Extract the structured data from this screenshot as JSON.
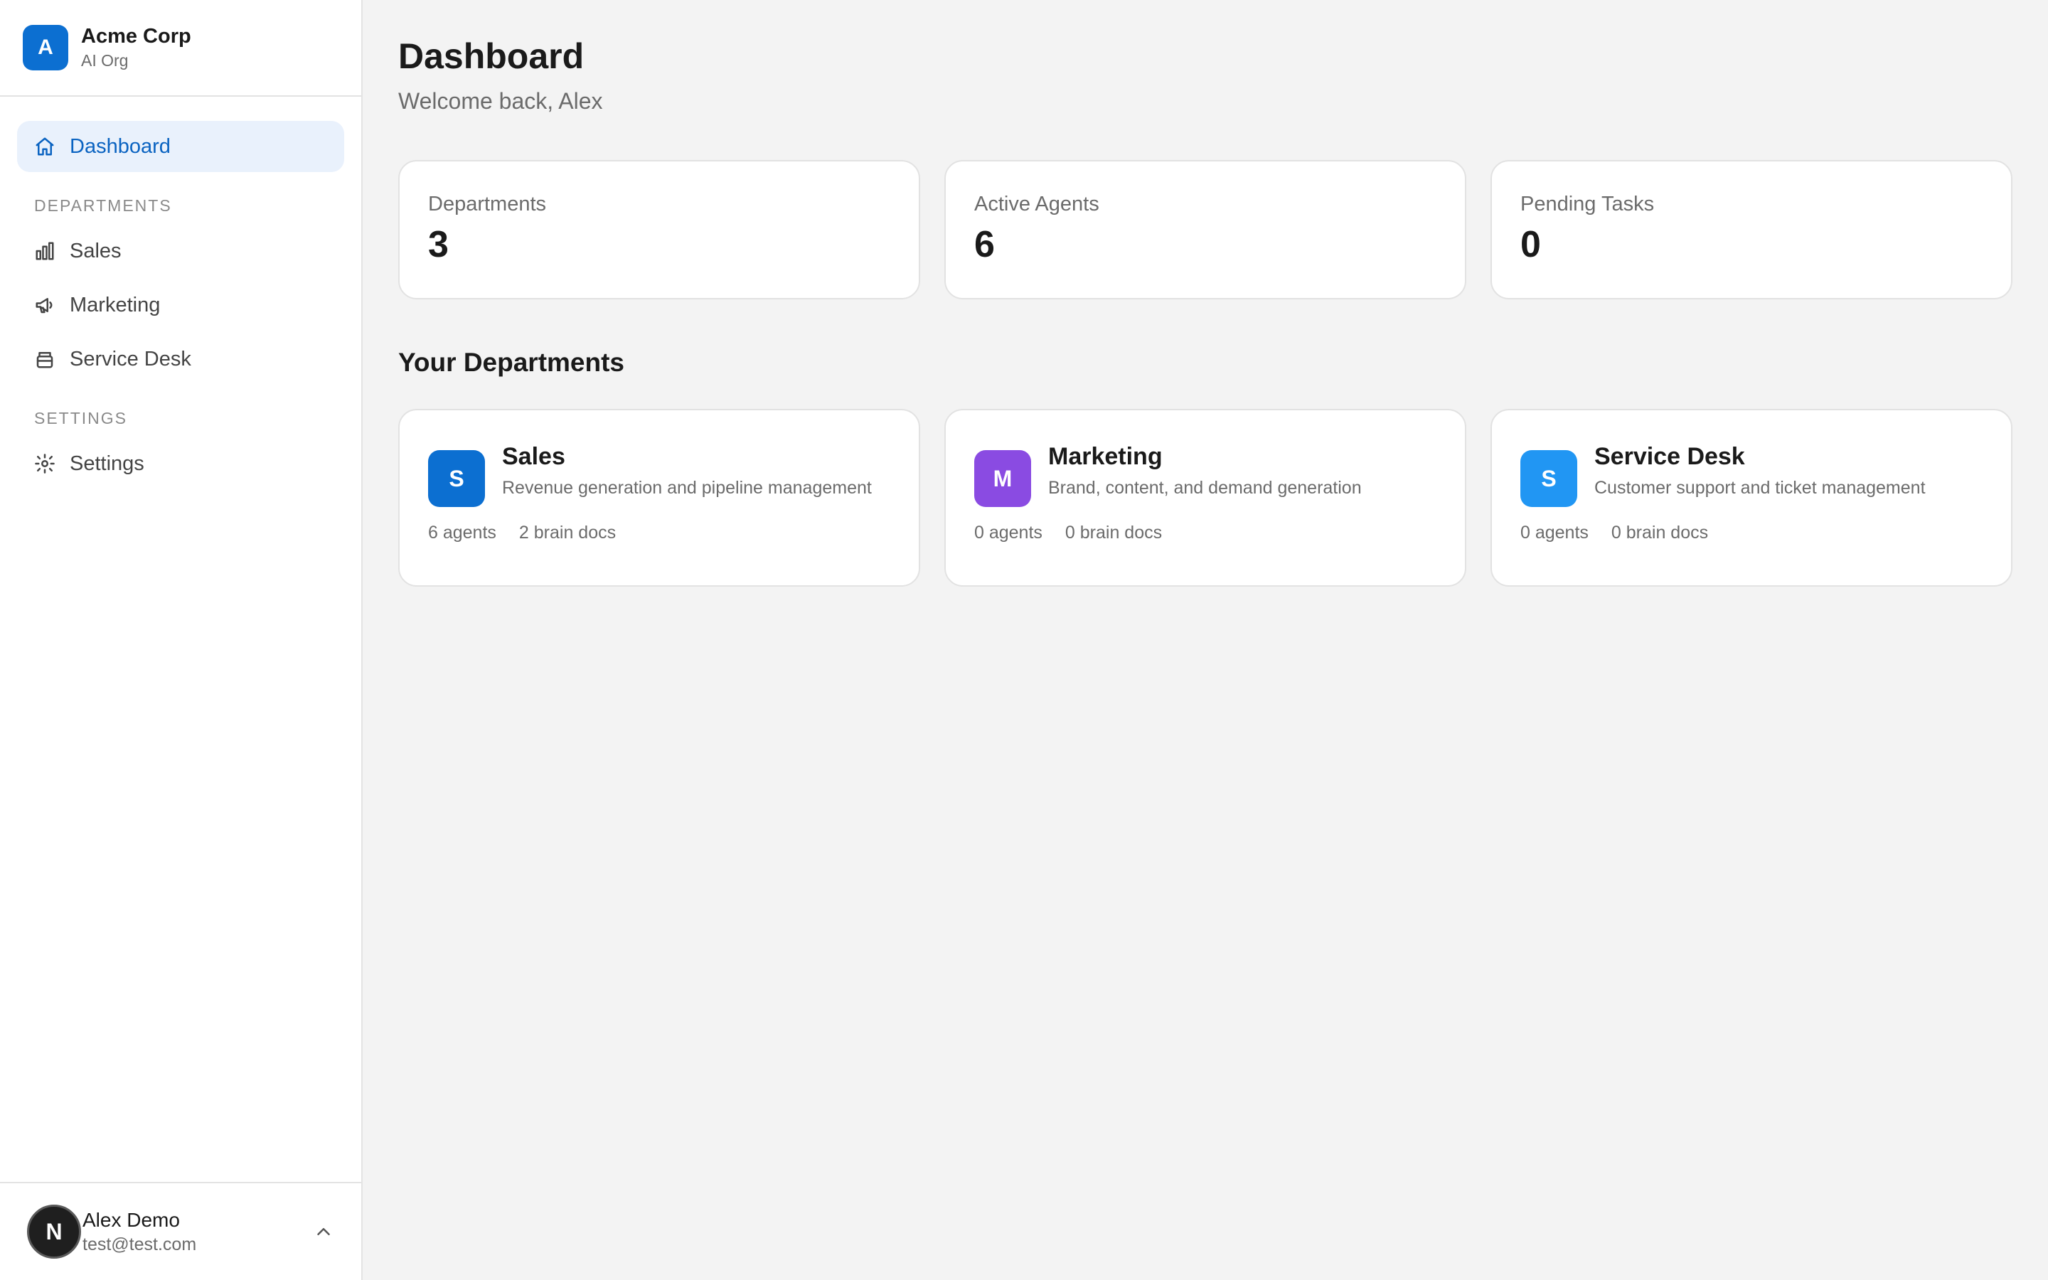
{
  "org": {
    "initial": "A",
    "name": "Acme Corp",
    "subtitle": "AI Org",
    "accent": "#0c6fd1"
  },
  "nav": {
    "dashboard": "Dashboard",
    "departments_heading": "DEPARTMENTS",
    "sales": "Sales",
    "marketing": "Marketing",
    "service_desk": "Service Desk",
    "settings_heading": "SETTINGS",
    "settings": "Settings"
  },
  "user": {
    "initial": "N",
    "name": "Alex Demo",
    "email": "test@test.com"
  },
  "page": {
    "title": "Dashboard",
    "subtitle": "Welcome back, Alex"
  },
  "stats": [
    {
      "label": "Departments",
      "value": "3"
    },
    {
      "label": "Active Agents",
      "value": "6"
    },
    {
      "label": "Pending Tasks",
      "value": "0"
    }
  ],
  "departments_title": "Your Departments",
  "departments": [
    {
      "initial": "S",
      "color": "#0c6fd1",
      "name": "Sales",
      "description": "Revenue generation and pipeline management",
      "agents": "6 agents",
      "docs": "2 brain docs"
    },
    {
      "initial": "M",
      "color": "#8a4be2",
      "name": "Marketing",
      "description": "Brand, content, and demand generation",
      "agents": "0 agents",
      "docs": "0 brain docs"
    },
    {
      "initial": "S",
      "color": "#2196f3",
      "name": "Service Desk",
      "description": "Customer support and ticket management",
      "agents": "0 agents",
      "docs": "0 brain docs"
    }
  ]
}
